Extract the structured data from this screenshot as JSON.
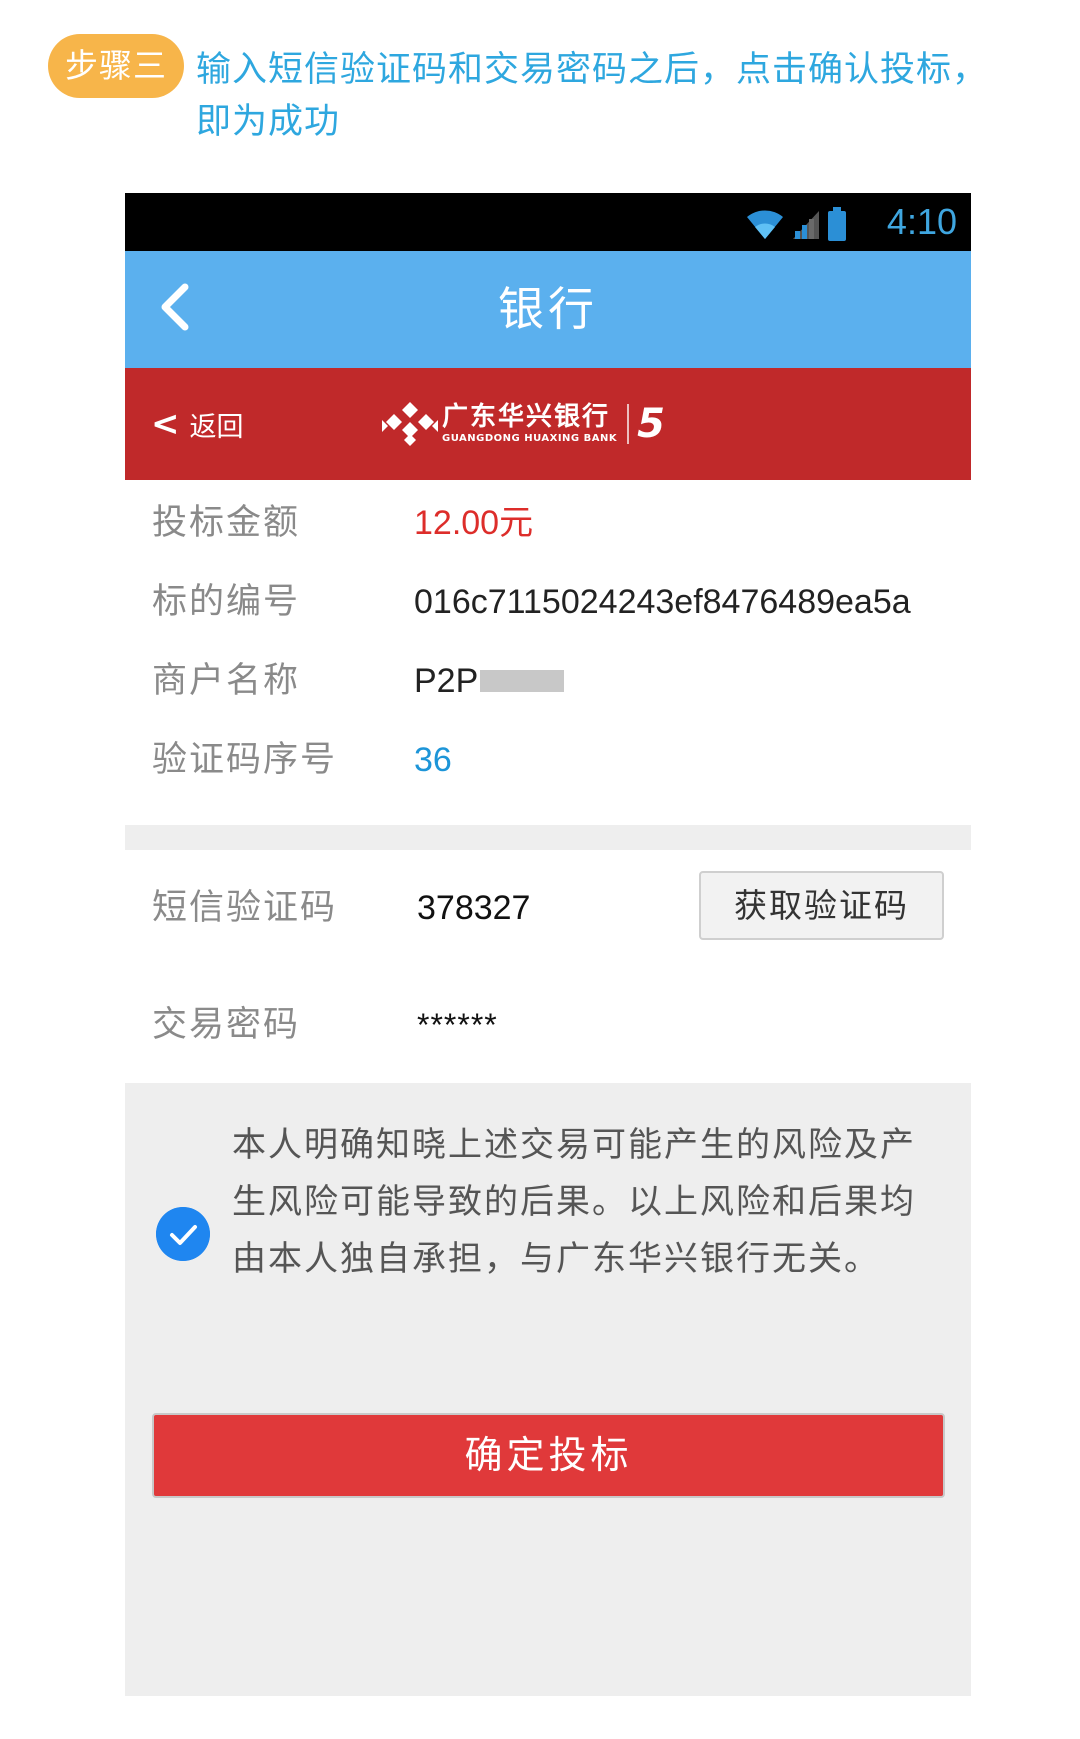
{
  "step": {
    "badge": "步骤三",
    "instruction": "输入短信验证码和交易密码之后，点击确认投标，即为成功"
  },
  "statusbar": {
    "time": "4:10",
    "icons": [
      "wifi-icon",
      "signal-icon",
      "battery-icon"
    ]
  },
  "appbar": {
    "title": "银行",
    "back_icon": "back-chevron-icon"
  },
  "bankbar": {
    "back_label": "返回",
    "back_arrow": "<",
    "bank_name_cn": "广东华兴银行",
    "bank_name_en": "GUANGDONG HUAXING BANK",
    "anniversary": "5"
  },
  "details": [
    {
      "label": "投标金额",
      "value": "12.00元",
      "style": "red"
    },
    {
      "label": "标的编号",
      "value": "016c7115024243ef8476489ea5a",
      "style": "normal"
    },
    {
      "label": "商户名称",
      "value": "P2P",
      "style": "normal",
      "masked": true
    },
    {
      "label": "验证码序号",
      "value": "36",
      "style": "blue"
    }
  ],
  "form": {
    "sms_label": "短信验证码",
    "sms_value": "378327",
    "sms_button": "获取验证码",
    "password_label": "交易密码",
    "password_value": "******"
  },
  "consent": {
    "checked": true,
    "text": "本人明确知晓上述交易可能产生的风险及产生风险可能导致的后果。以上风险和后果均由本人独自承担，与广东华兴银行无关。"
  },
  "submit": {
    "label": "确定投标"
  },
  "colors": {
    "step_badge": "#f7b54a",
    "step_text": "#2ea7df",
    "appbar": "#5bb0ee",
    "bankbar": "#c0292a",
    "amount": "#dd2d2a",
    "serial": "#1d95d8",
    "checkbox": "#1f86f0",
    "submit": "#e0393a"
  }
}
